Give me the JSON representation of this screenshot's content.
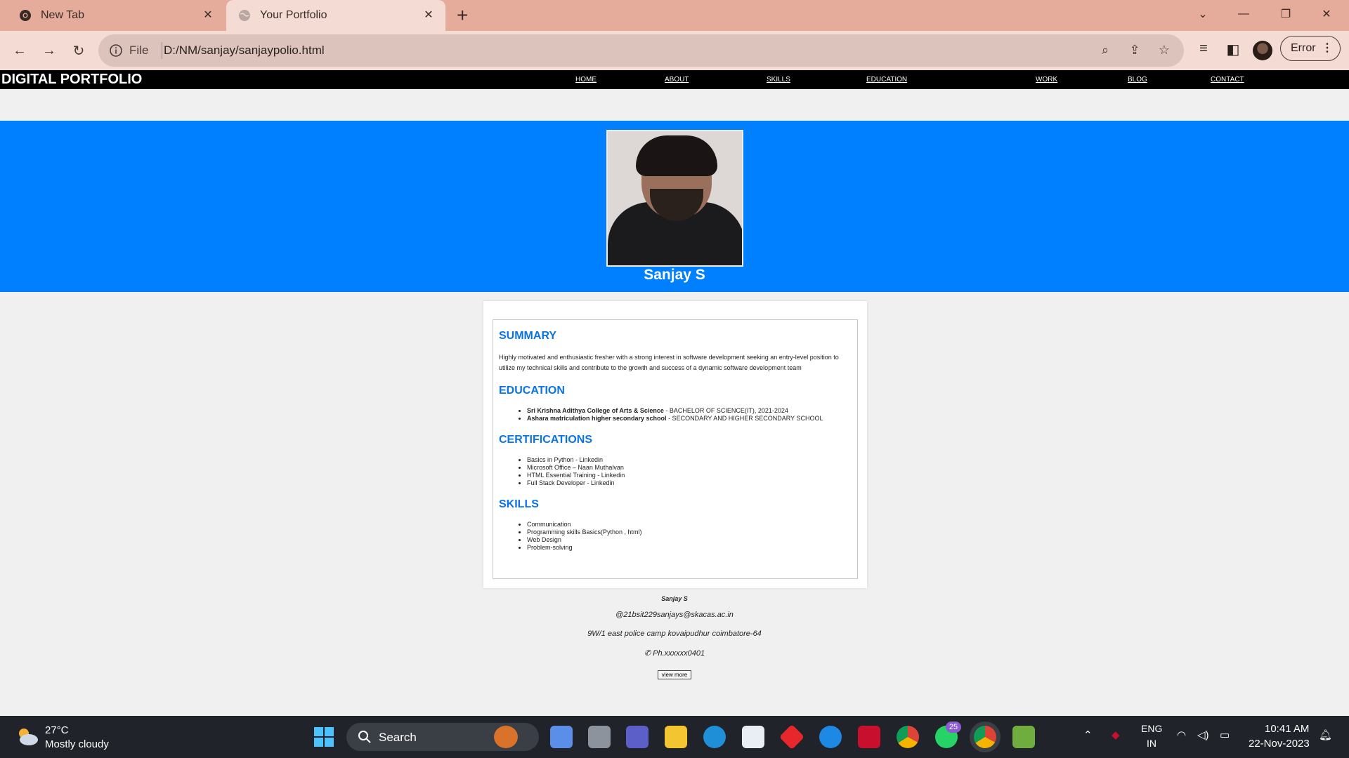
{
  "browser": {
    "tabs": [
      {
        "title": "New Tab",
        "active": false
      },
      {
        "title": "Your Portfolio",
        "active": true
      }
    ],
    "address": {
      "scheme_label": "File",
      "url": "D:/NM/sanjay/sanjaypolio.html"
    },
    "profile_button_label": "Error"
  },
  "site": {
    "brand": "DIGITAL PORTFOLIO",
    "nav": [
      "HOME",
      "ABOUT",
      "SKILLS",
      "EDUCATION",
      "WORK",
      "BLOG",
      "CONTACT"
    ],
    "hero_name": "Sanjay S",
    "hero_color": "#0080ff",
    "sections": {
      "summary_title": "SUMMARY",
      "summary_text": "Highly motivated and enthusiastic fresher with a strong interest in software development seeking an entry-level position to utilize my technical skills and contribute to the growth and success of a dynamic software development team",
      "education_title": "EDUCATION",
      "education": [
        {
          "school": "Sri Krishna Adithya College of Arts & Science",
          "detail": " - BACHELOR OF SCIENCE(IT), 2021-2024"
        },
        {
          "school": "Ashara matriculation higher secondary school",
          "detail": " - SECONDARY AND HIGHER SECONDARY SCHOOL"
        }
      ],
      "certifications_title": "CERTIFICATIONS",
      "certifications": [
        "Basics in Python - Linkedin",
        "Microsoft Office – Naan Muthalvan",
        "HTML Essential Training - Linkedin",
        "Full Stack Developer - Linkedin"
      ],
      "skills_title": "SKILLS",
      "skills": [
        "Communication",
        "Programming skills Basics(Python , html)",
        "Web Design",
        "Problem-solving"
      ]
    },
    "footer": {
      "name": "Sanjay S",
      "email": "@21bsit229sanjays@skacas.ac.in",
      "address": "9W/1 east police camp kovaipudhur coimbatore-64",
      "phone": "✆ Ph.xxxxxx0401",
      "button": "view more"
    }
  },
  "taskbar": {
    "weather_temp": "27°C",
    "weather_cond": "Mostly cloudy",
    "search_label": "Search",
    "whatsapp_badge": "25",
    "lang_line1": "ENG",
    "lang_line2": "IN",
    "time": "10:41 AM",
    "date": "22-Nov-2023"
  }
}
